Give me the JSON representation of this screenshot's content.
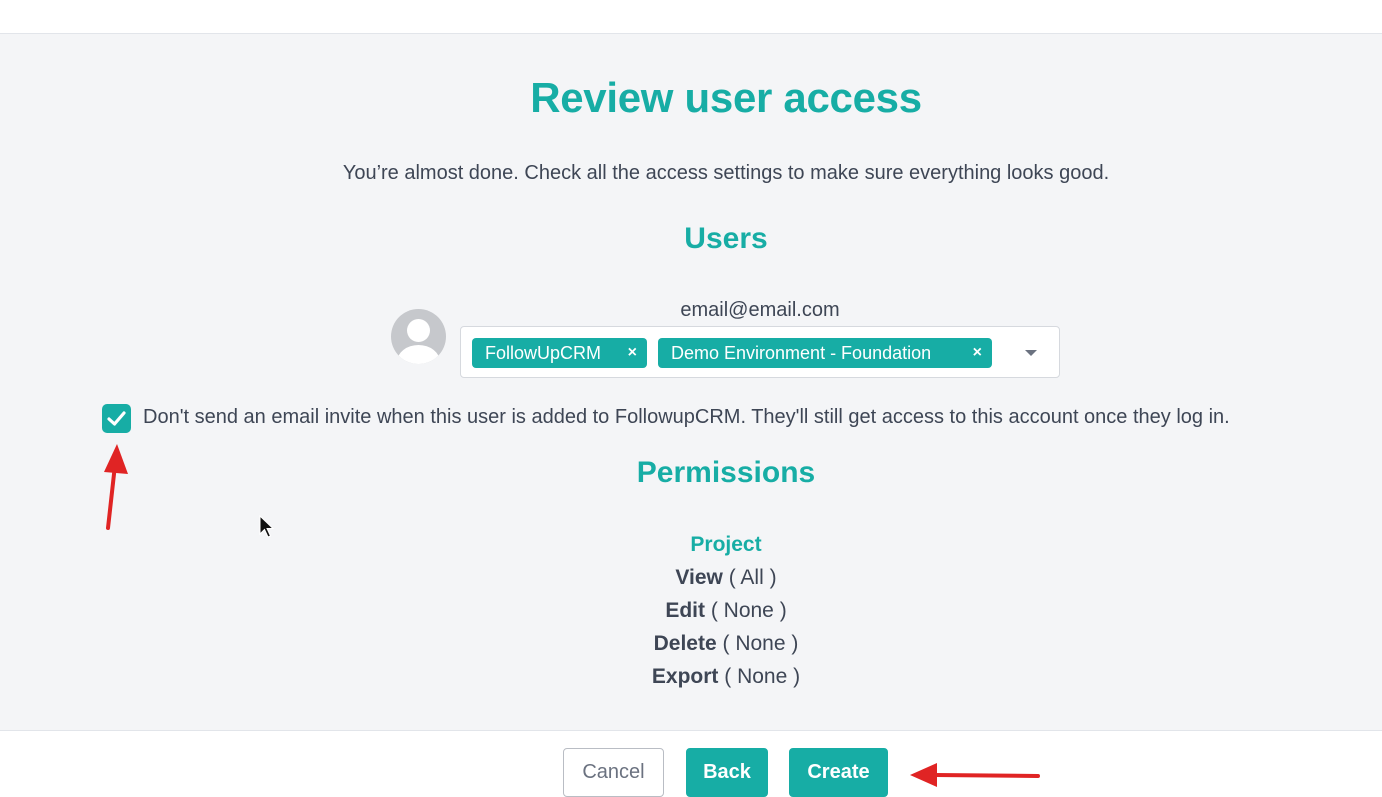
{
  "page": {
    "title": "Review user access",
    "subtitle": "You’re almost done. Check all the access settings to make sure everything looks good."
  },
  "users_section": {
    "heading": "Users",
    "email": "email@email.com",
    "tags": [
      {
        "label": "FollowUpCRM",
        "remove": "×"
      },
      {
        "label": "Demo Environment - Foundation",
        "remove": "×"
      }
    ],
    "avatar_icon": "user-avatar-icon",
    "dropdown_icon": "caret-down-icon"
  },
  "email_option": {
    "checked": true,
    "label": "Don't send an email invite when this user is added to FollowupCRM. They'll still get access to this account once they log in."
  },
  "permissions": {
    "heading": "Permissions",
    "category": "Project",
    "items": [
      {
        "name": "View",
        "value": "( All )"
      },
      {
        "name": "Edit",
        "value": "( None )"
      },
      {
        "name": "Delete",
        "value": "( None )"
      },
      {
        "name": "Export",
        "value": "( None )"
      }
    ]
  },
  "footer": {
    "cancel": "Cancel",
    "back": "Back",
    "create": "Create"
  },
  "colors": {
    "accent": "#17ada5",
    "annotation_arrow": "#e02424",
    "background": "#f4f5f7"
  }
}
